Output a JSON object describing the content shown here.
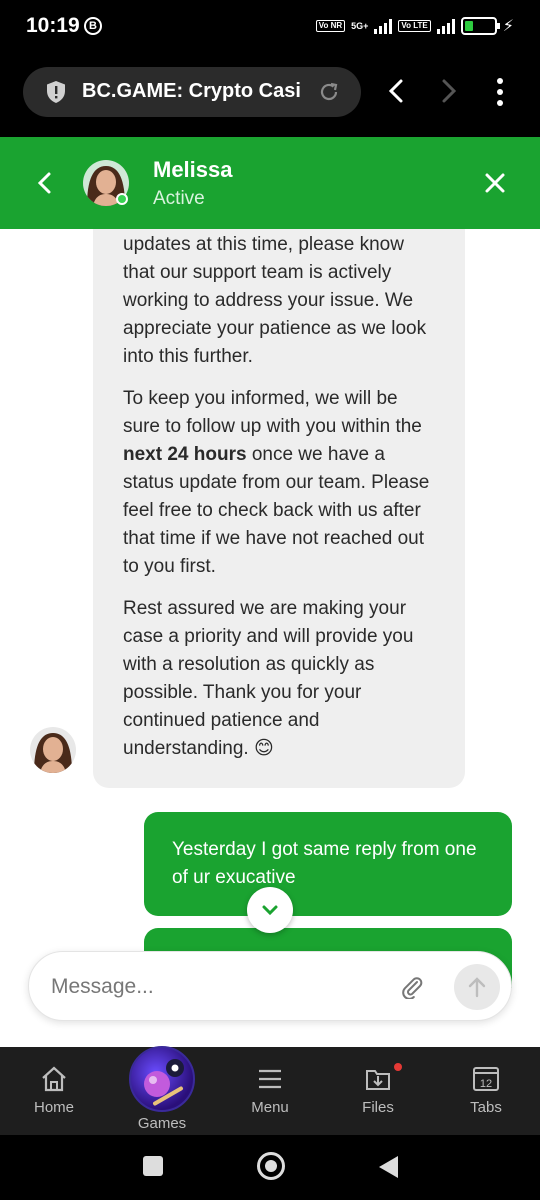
{
  "status_bar": {
    "time": "10:19",
    "app_badge": "B",
    "network": "5G+",
    "volte_left": "Vo NR",
    "volte_right": "Vo LTE",
    "battery": "30"
  },
  "browser": {
    "url_title": "BC.GAME: Crypto Casi..."
  },
  "chat_header": {
    "agent_name": "Melissa",
    "agent_status": "Active"
  },
  "messages": {
    "agent_p1": "updates at this time, please know that our support team is actively working to address your issue. We appreciate your patience as we look into this further.",
    "agent_p2_before": "To keep you informed, we will be sure to follow up with you within the ",
    "agent_p2_bold": "next 24 hours",
    "agent_p2_after": " once we have a status update from our team. Please feel free to check back with us after that time if we have not reached out to you first.",
    "agent_p3": "Rest assured we are making your case a priority and will provide you with a resolution as quickly as possible. Thank you for your continued patience and understanding. 😊",
    "user_msg_1": "Yesterday I got same reply from one of ur exucative"
  },
  "composer": {
    "placeholder": "Message..."
  },
  "bottom_nav": {
    "home": "Home",
    "games": "Games",
    "menu": "Menu",
    "files": "Files",
    "tabs": "Tabs",
    "tab_count": "12"
  },
  "colors": {
    "brand_green": "#1aa330",
    "agent_bubble": "#efefef"
  }
}
